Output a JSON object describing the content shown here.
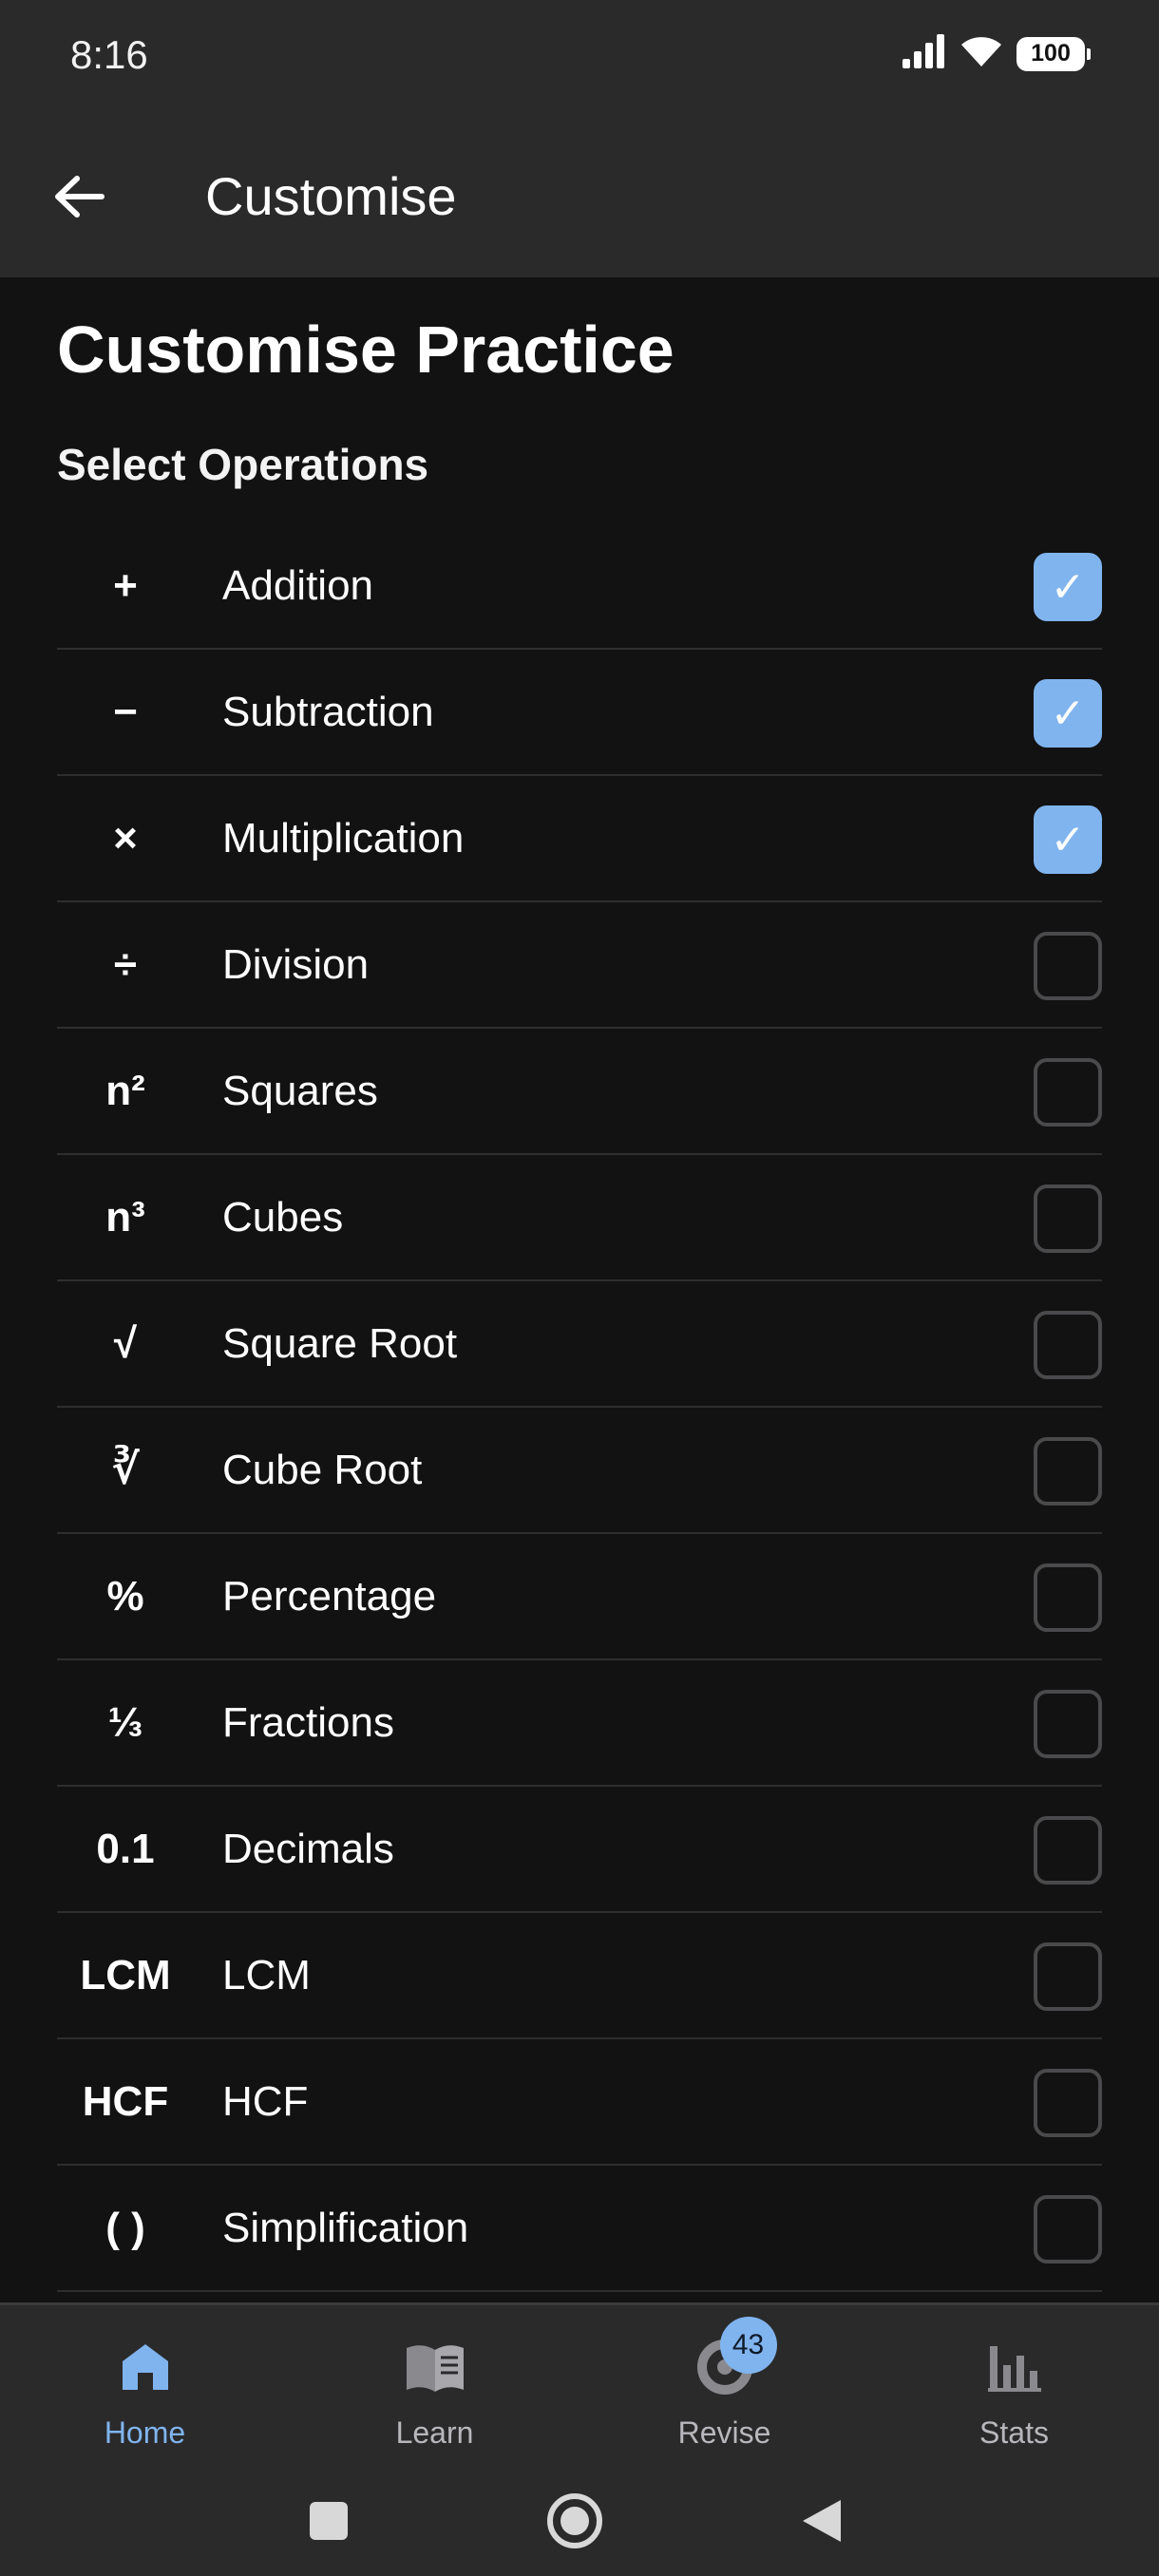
{
  "status_bar": {
    "time": "8:16",
    "battery": "100"
  },
  "app_bar": {
    "title": "Customise"
  },
  "page": {
    "title": "Customise Practice",
    "section_title": "Select Operations"
  },
  "operations": [
    {
      "symbol": "+",
      "label": "Addition",
      "checked": true
    },
    {
      "symbol": "−",
      "label": "Subtraction",
      "checked": true
    },
    {
      "symbol": "×",
      "label": "Multiplication",
      "checked": true
    },
    {
      "symbol": "÷",
      "label": "Division",
      "checked": false
    },
    {
      "symbol": "n²",
      "label": "Squares",
      "checked": false
    },
    {
      "symbol": "n³",
      "label": "Cubes",
      "checked": false
    },
    {
      "symbol": "√",
      "label": "Square Root",
      "checked": false
    },
    {
      "symbol": "∛",
      "label": "Cube Root",
      "checked": false
    },
    {
      "symbol": "%",
      "label": "Percentage",
      "checked": false
    },
    {
      "symbol": "⅓",
      "label": "Fractions",
      "checked": false
    },
    {
      "symbol": "0.1",
      "label": "Decimals",
      "checked": false
    },
    {
      "symbol": "LCM",
      "label": "LCM",
      "checked": false
    },
    {
      "symbol": "HCF",
      "label": "HCF",
      "checked": false
    },
    {
      "symbol": "( )",
      "label": "Simplification",
      "checked": false
    }
  ],
  "bottom_nav": {
    "items": [
      {
        "label": "Home",
        "icon": "home-icon",
        "active": true
      },
      {
        "label": "Learn",
        "icon": "book-icon",
        "active": false
      },
      {
        "label": "Revise",
        "icon": "revise-icon",
        "active": false,
        "badge": "43"
      },
      {
        "label": "Stats",
        "icon": "stats-icon",
        "active": false
      }
    ]
  },
  "colors": {
    "accent": "#80b4ee",
    "background": "#121212",
    "bar": "#2a2a2b",
    "divider": "#2e2e30"
  }
}
